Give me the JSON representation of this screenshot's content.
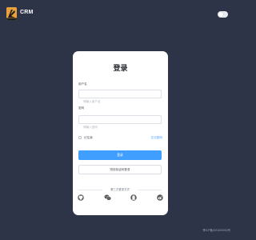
{
  "app": {
    "brand_name": "CRM",
    "accent_color": "#409eff",
    "background_color": "#2d3447"
  },
  "theme_toggle": {
    "state": "light"
  },
  "login": {
    "title": "登录",
    "username_label": "用户名",
    "username_placeholder": "请输入用户名",
    "password_label": "密码",
    "password_placeholder": "请输入密码",
    "remember_label": "记住我",
    "forgot_label": "忘记密码",
    "login_button": "登录",
    "code_login_button": "短信验证码登录",
    "other_methods_label": "第三方登录方式",
    "social_icons": [
      "github-icon",
      "wechat-icon",
      "qq-icon",
      "weibo-icon"
    ]
  },
  "footer": {
    "text": "青ICP备2021000002号"
  }
}
